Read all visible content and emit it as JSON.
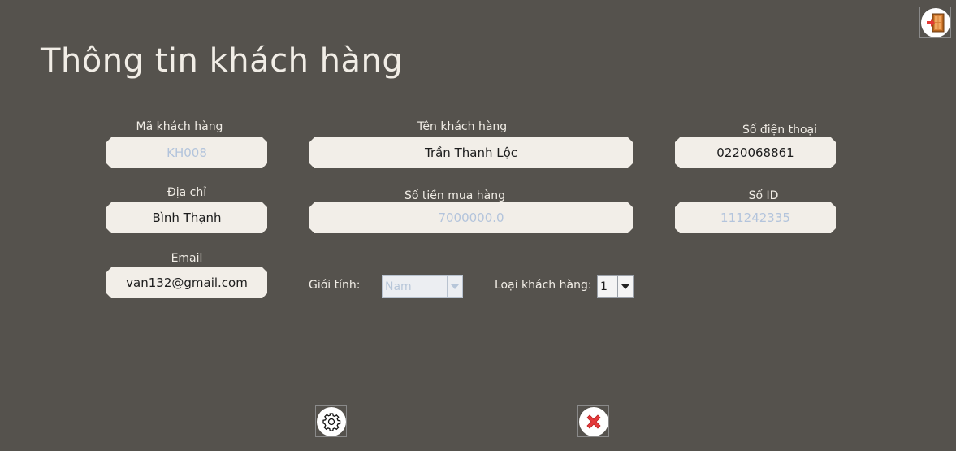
{
  "title": "Thông tin khách hàng",
  "fields": {
    "ma_khach_hang": {
      "label": "Mã khách hàng",
      "value": "KH008"
    },
    "ten_khach_hang": {
      "label": "Tên khách hàng",
      "value": "Trần Thanh Lộc"
    },
    "so_dien_thoai": {
      "label": "Số điện thoại",
      "value": "0220068861"
    },
    "dia_chi": {
      "label": "Địa chỉ",
      "value": "Bình Thạnh"
    },
    "so_tien_mua_hang": {
      "label": "Số tiền mua hàng",
      "value": "7000000.0"
    },
    "so_id": {
      "label": "Số ID",
      "value": "111242335"
    },
    "email": {
      "label": "Email",
      "value": "van132@gmail.com"
    }
  },
  "gioi_tinh": {
    "label": "Giới tính:",
    "value": "Nam"
  },
  "loai_khach_hang": {
    "label": "Loại khách hàng:",
    "value": "1"
  },
  "icons": {
    "exit": "exit-door-icon",
    "settings": "gear-icon",
    "cancel": "close-icon"
  },
  "colors": {
    "background": "#55524d",
    "field": "#f2eee8",
    "disabled_text": "#b3c4dc",
    "cancel_red": "#e5393b"
  }
}
